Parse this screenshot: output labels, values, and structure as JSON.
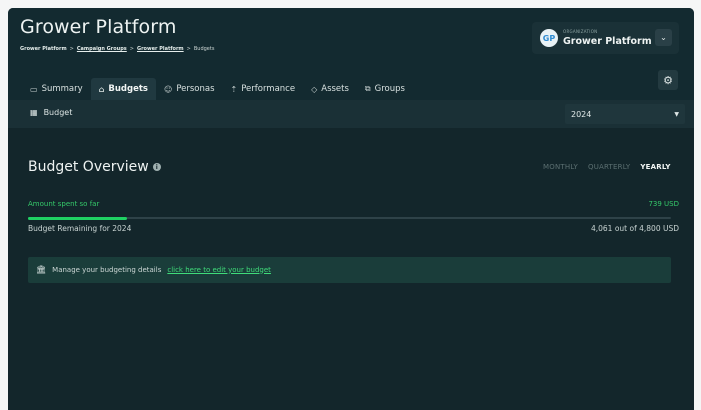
{
  "header": {
    "title": "Grower Platform",
    "breadcrumb": {
      "items": [
        {
          "label": "Grower Platform",
          "link": false
        },
        {
          "label": "Campaign Groups",
          "link": true
        },
        {
          "label": "Grower Platform",
          "link": true
        },
        {
          "label": "Budgets",
          "link": false
        }
      ],
      "separator": ">"
    }
  },
  "organization": {
    "logo_text": "GP",
    "caption": "ORGANIZATION",
    "name": "Grower Platform",
    "toggle_icon": "chevron-down-icon"
  },
  "settings_icon": "settings-icon",
  "tabs": [
    {
      "label": "Summary",
      "icon": "summary-icon",
      "active": false
    },
    {
      "label": "Budgets",
      "icon": "budgets-icon",
      "active": true
    },
    {
      "label": "Personas",
      "icon": "personas-icon",
      "active": false
    },
    {
      "label": "Performance",
      "icon": "performance-icon",
      "active": false
    },
    {
      "label": "Assets",
      "icon": "assets-icon",
      "active": false
    },
    {
      "label": "Groups",
      "icon": "groups-icon",
      "active": false
    }
  ],
  "toolbar": {
    "label": "Budget",
    "icon": "budget-icon",
    "year_select": {
      "value": "2024"
    }
  },
  "overview": {
    "title": "Budget Overview",
    "info_icon": "info-icon",
    "periods": [
      {
        "label": "MONTHLY",
        "active": false
      },
      {
        "label": "QUARTERLY",
        "active": false
      },
      {
        "label": "YEARLY",
        "active": true
      }
    ],
    "spent_label": "Amount spent so far",
    "spent_value": "739 USD",
    "progress_fraction": 0.154,
    "remaining_label": "Budget Remaining for 2024",
    "remaining_value": "4,061 out of 4,800 USD",
    "manage_text": "Manage your budgeting details",
    "manage_link": "click here to edit your budget",
    "manage_icon": "bank-icon"
  },
  "colors": {
    "background": "#13262b",
    "accent_green": "#35c96a",
    "progress_green": "#1fd163"
  }
}
